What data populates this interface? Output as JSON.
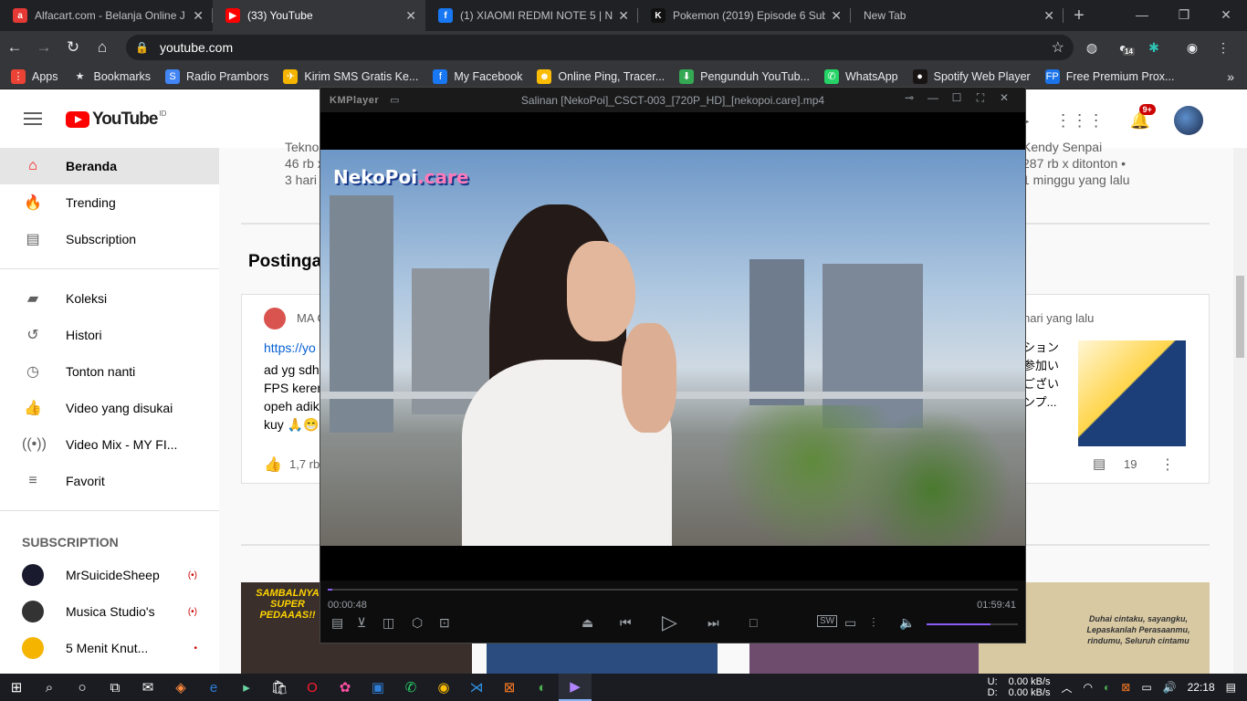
{
  "browser": {
    "tabs": [
      {
        "title": "Alfacart.com - Belanja Online J",
        "favicon": "alfacart-icon",
        "color": "#e53935",
        "glyph": "a",
        "active": false
      },
      {
        "title": "(33) YouTube",
        "favicon": "youtube-icon",
        "color": "#ff0000",
        "glyph": "▶",
        "active": true
      },
      {
        "title": "(1) XIAOMI REDMI NOTE 5 | NC",
        "favicon": "facebook-icon",
        "color": "#1877f2",
        "glyph": "f",
        "active": false
      },
      {
        "title": "Pokemon (2019) Episode 6 Sub",
        "favicon": "k-icon",
        "color": "#111111",
        "glyph": "K",
        "active": false
      },
      {
        "title": "New Tab",
        "favicon": "",
        "color": "",
        "glyph": "",
        "active": false
      }
    ],
    "url": "youtube.com",
    "bookmarks": [
      {
        "label": "Apps",
        "icon": "apps-grid-icon",
        "color": "#ea4335",
        "glyph": "⋮"
      },
      {
        "label": "Bookmarks",
        "icon": "star-icon",
        "color": "",
        "glyph": "★"
      },
      {
        "label": "Radio Prambors",
        "icon": "prambors-icon",
        "color": "#4285f4",
        "glyph": "S"
      },
      {
        "label": "Kirim SMS Gratis Ke...",
        "icon": "sms-icon",
        "color": "#f4b400",
        "glyph": "✈"
      },
      {
        "label": "My Facebook",
        "icon": "facebook-icon",
        "color": "#1877f2",
        "glyph": "f"
      },
      {
        "label": "Online Ping, Tracer...",
        "icon": "ping-icon",
        "color": "#fbbc04",
        "glyph": "☻"
      },
      {
        "label": "Pengunduh YouTub...",
        "icon": "download-icon",
        "color": "#34a853",
        "glyph": "⬇"
      },
      {
        "label": "WhatsApp",
        "icon": "whatsapp-icon",
        "color": "#25d366",
        "glyph": "✆"
      },
      {
        "label": "Spotify Web Player",
        "icon": "spotify-icon",
        "color": "#191414",
        "glyph": "●"
      },
      {
        "label": "Free Premium Prox...",
        "icon": "proxy-icon",
        "color": "#1a73e8",
        "glyph": "FP"
      }
    ],
    "extension_badge": "14"
  },
  "youtube": {
    "logo_text": "YouTube",
    "logo_region": "ID",
    "notification_count": "9+",
    "sidebar": {
      "main": [
        {
          "label": "Beranda",
          "icon": "home-icon",
          "glyph": "⌂",
          "selected": true
        },
        {
          "label": "Trending",
          "icon": "trending-icon",
          "glyph": "🔥"
        },
        {
          "label": "Subscription",
          "icon": "subscriptions-icon",
          "glyph": "▤"
        }
      ],
      "library": [
        {
          "label": "Koleksi",
          "icon": "folder-icon",
          "glyph": "▰"
        },
        {
          "label": "Histori",
          "icon": "history-icon",
          "glyph": "↺"
        },
        {
          "label": "Tonton nanti",
          "icon": "clock-icon",
          "glyph": "◷"
        },
        {
          "label": "Video yang disukai",
          "icon": "thumbs-up-icon",
          "glyph": "👍"
        },
        {
          "label": "Video Mix - MY FI...",
          "icon": "radio-icon",
          "glyph": "((•))"
        },
        {
          "label": "Favorit",
          "icon": "playlist-icon",
          "glyph": "≡"
        }
      ],
      "subscription_header": "SUBSCRIPTION",
      "subscriptions": [
        {
          "label": "MrSuicideSheep",
          "color": "#1a1a2e",
          "status": "(•)"
        },
        {
          "label": "Musica Studio's",
          "color": "#333333",
          "status": "(•)"
        },
        {
          "label": "5 Menit Knut...",
          "color": "#f4b400",
          "status": "•"
        }
      ]
    },
    "top_left_meta": [
      "Teknol",
      "46 rb x",
      "3 hari"
    ],
    "top_right_meta": [
      "Kendy Senpai",
      "287 rb x ditonton •",
      "1 minggu yang lalu"
    ],
    "section_title": "Postinga",
    "post": {
      "author": "MA C",
      "link": "https://yo",
      "lines": [
        "ad yg sdh",
        "FPS keren",
        "opeh adik",
        "kuy 🙏😁"
      ],
      "likes": "1,7 rb"
    },
    "post2": {
      "time": "hari yang lalu",
      "jp_lines": [
        "ション",
        "参加い",
        "ござい",
        "ンプ..."
      ],
      "comments": "19"
    },
    "thumbnails": [
      {
        "caption": "SAMBALNYA SUPER PEDAAAS!!",
        "color": "#3a2f2a"
      },
      {
        "caption": "",
        "color": "#2b4c7e"
      },
      {
        "caption": "",
        "color": "#6e4c6e"
      },
      {
        "caption": "Duhai cintaku, sayangku, Lepaskanlah Perasaanmu, rindumu, Seluruh cintamu",
        "color": "#d8c9a3"
      }
    ]
  },
  "kmplayer": {
    "app_name": "KMPlayer",
    "file_name": "Salinan [NekoPoi]_CSCT-003_[720P_HD]_[nekopoi.care].mp4",
    "watermark": "NekoPoi",
    "watermark_tld": ".care",
    "elapsed": "00:00:48",
    "total": "01:59:41",
    "progress": 0.007,
    "volume": 0.7
  },
  "taskbar": {
    "net_up_label": "U:",
    "net_down_label": "D:",
    "net_up": "0.00 kB/s",
    "net_down": "0.00 kB/s",
    "time": "22:18"
  }
}
